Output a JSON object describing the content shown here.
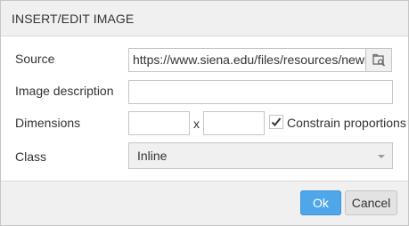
{
  "dialog": {
    "title": "INSERT/EDIT IMAGE"
  },
  "fields": {
    "source": {
      "label": "Source",
      "value": "https://www.siena.edu/files/resources/newman",
      "browse_icon": "browse-image-icon"
    },
    "description": {
      "label": "Image description",
      "value": ""
    },
    "dimensions": {
      "label": "Dimensions",
      "width": "",
      "height": "",
      "separator": "x",
      "constrain_label": "Constrain proportions",
      "constrain_checked": true
    },
    "class": {
      "label": "Class",
      "selected": "Inline"
    }
  },
  "buttons": {
    "ok": "Ok",
    "cancel": "Cancel"
  },
  "colors": {
    "accent": "#4fa7ea",
    "panel_bg": "#f0f0f0",
    "border": "#c5c5c5"
  }
}
